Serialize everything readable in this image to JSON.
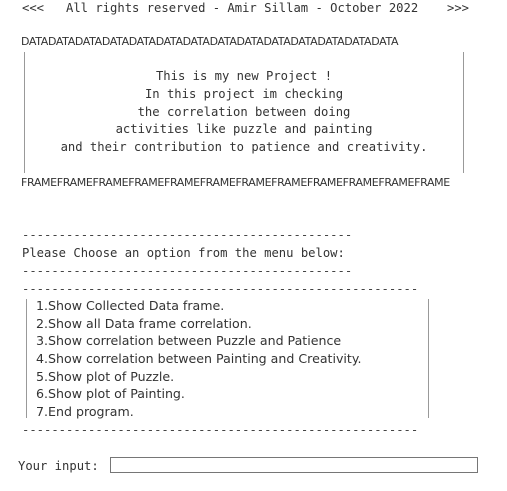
{
  "header": {
    "left_marker": "<<<",
    "text": "All rights reserved - Amir Sillam - October 2022",
    "right_marker": ">>>"
  },
  "frame": {
    "top_border": "DATADATADATADATADATADATADATADATADATADATADATADATADATADATA",
    "bottom_border": "FRAMEFRAMEFRAMEFRAMEFRAMEFRAMEFRAMEFRAMEFRAMEFRAMEFRAMEFRAME",
    "lines": [
      "This is my new Project !",
      "In this project im checking",
      "the correlation between doing",
      "activities like puzzle and painting",
      "and their contribution to patience and creativity."
    ]
  },
  "prompt": {
    "dashes": "---------------------------------------------",
    "text": "Please Choose an option from the menu below:"
  },
  "menu": {
    "dashes": "------------------------------------------------------",
    "items": [
      "1.Show Collected Data frame.",
      "2.Show all Data frame correlation.",
      "3.Show correlation between Puzzle and Patience",
      "4.Show correlation between Painting and Creativity.",
      "5.Show plot of Puzzle.",
      "6.Show plot of Painting.",
      "7.End program."
    ]
  },
  "input": {
    "label": "Your input:",
    "value": ""
  }
}
